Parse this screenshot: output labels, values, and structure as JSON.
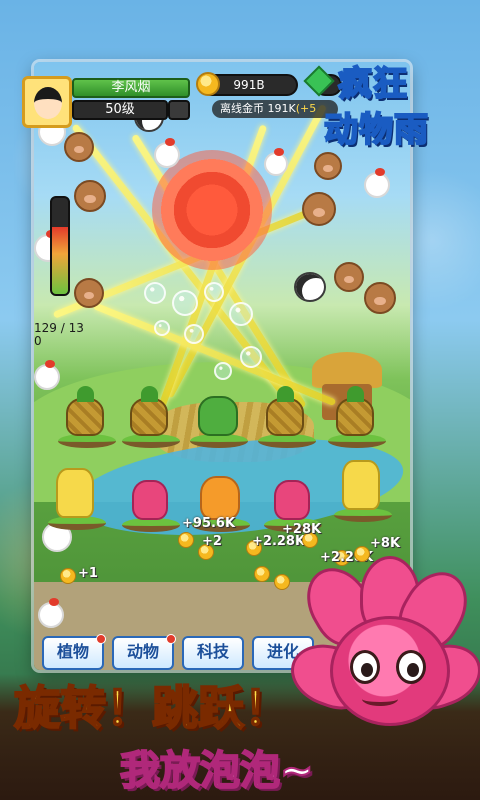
{
  "player": {
    "name": "李风烟",
    "level": "50级"
  },
  "resources": {
    "gold": "991B",
    "offline_label": "离线金币",
    "offline_value": "191K",
    "offline_rate": "(+5"
  },
  "logo": {
    "line1": "疯狂",
    "line2": "动物雨"
  },
  "counter": {
    "line1": "129 / 13",
    "line2": "0"
  },
  "energy_level": 0.7,
  "floating_gains": [
    "+95.6K",
    "+2",
    "+2.28K",
    "+28K",
    "+1",
    "+2.28K",
    "+8K"
  ],
  "tabs": [
    {
      "label": "植物",
      "has_alert": true
    },
    {
      "label": "动物",
      "has_alert": true
    },
    {
      "label": "科技",
      "has_alert": false
    },
    {
      "label": "进化",
      "has_alert": false
    }
  ],
  "banner": {
    "slogan1": "旋转！跳跃！",
    "slogan2": "我放泡泡~"
  }
}
